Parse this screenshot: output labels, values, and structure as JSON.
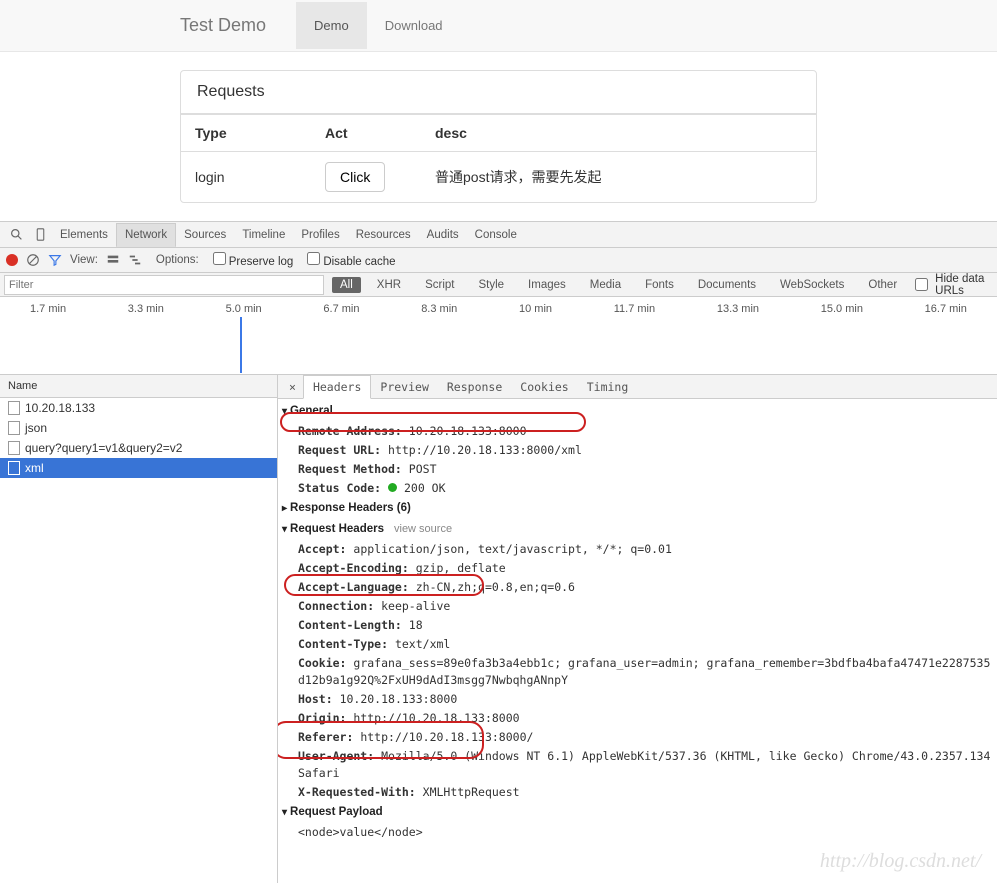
{
  "app": {
    "title": "Test Demo",
    "nav": [
      {
        "label": "Demo",
        "active": true
      },
      {
        "label": "Download",
        "active": false
      }
    ]
  },
  "panel": {
    "title": "Requests",
    "columns": [
      "Type",
      "Act",
      "desc"
    ],
    "rows": [
      {
        "type": "login",
        "act_btn": "Click",
        "desc": "普通post请求，需要先发起"
      }
    ]
  },
  "devtools": {
    "tools": {
      "search_icon": "search-icon",
      "device_icon": "device-icon"
    },
    "tabs": [
      "Elements",
      "Network",
      "Sources",
      "Timeline",
      "Profiles",
      "Resources",
      "Audits",
      "Console"
    ],
    "tabs_active": "Network",
    "row2": {
      "view_label": "View:",
      "options_label": "Options:",
      "preserve_log": "Preserve log",
      "disable_cache": "Disable cache"
    },
    "row3": {
      "filter_placeholder": "Filter",
      "types": [
        "All",
        "XHR",
        "Script",
        "Style",
        "Images",
        "Media",
        "Fonts",
        "Documents",
        "WebSockets",
        "Other"
      ],
      "type_active": "All",
      "hide_data_urls": "Hide data URLs"
    },
    "timeline_ticks": [
      "1.7 min",
      "3.3 min",
      "5.0 min",
      "6.7 min",
      "8.3 min",
      "10 min",
      "11.7 min",
      "13.3 min",
      "15.0 min",
      "16.7 min"
    ],
    "requests_header": "Name",
    "requests": [
      {
        "name": "10.20.18.133",
        "selected": false
      },
      {
        "name": "json",
        "selected": false
      },
      {
        "name": "query?query1=v1&query2=v2",
        "selected": false
      },
      {
        "name": "xml",
        "selected": true
      }
    ],
    "detail_tabs": [
      "Headers",
      "Preview",
      "Response",
      "Cookies",
      "Timing"
    ],
    "detail_tab_active": "Headers",
    "general": {
      "title": "General",
      "remote_address": {
        "k": "Remote Address:",
        "v": "10.20.18.133:8000"
      },
      "request_url": {
        "k": "Request URL:",
        "v": "http://10.20.18.133:8000/xml"
      },
      "request_method": {
        "k": "Request Method:",
        "v": "POST"
      },
      "status_code": {
        "k": "Status Code:",
        "v": "200 OK"
      }
    },
    "response_headers": {
      "title": "Response Headers (6)"
    },
    "request_headers": {
      "title": "Request Headers",
      "view_source": "view source",
      "items": [
        {
          "k": "Accept:",
          "v": "application/json, text/javascript, */*; q=0.01"
        },
        {
          "k": "Accept-Encoding:",
          "v": "gzip, deflate"
        },
        {
          "k": "Accept-Language:",
          "v": "zh-CN,zh;q=0.8,en;q=0.6"
        },
        {
          "k": "Connection:",
          "v": "keep-alive"
        },
        {
          "k": "Content-Length:",
          "v": "18"
        },
        {
          "k": "Content-Type:",
          "v": "text/xml"
        },
        {
          "k": "Cookie:",
          "v": "grafana_sess=89e0fa3b3a4ebb1c; grafana_user=admin; grafana_remember=3bdfba4bafa47471e2287535d12b9a1g92Q%2FxUH9dAdI3msgg7NwbqhgANnpY"
        },
        {
          "k": "Host:",
          "v": "10.20.18.133:8000"
        },
        {
          "k": "Origin:",
          "v": "http://10.20.18.133:8000"
        },
        {
          "k": "Referer:",
          "v": "http://10.20.18.133:8000/"
        },
        {
          "k": "User-Agent:",
          "v": "Mozilla/5.0 (Windows NT 6.1) AppleWebKit/537.36 (KHTML, like Gecko) Chrome/43.0.2357.134 Safari"
        },
        {
          "k": "X-Requested-With:",
          "v": "XMLHttpRequest"
        }
      ]
    },
    "request_payload": {
      "title": "Request Payload",
      "body": "<node>value</node>"
    }
  },
  "watermark": "http://blog.csdn.net/"
}
